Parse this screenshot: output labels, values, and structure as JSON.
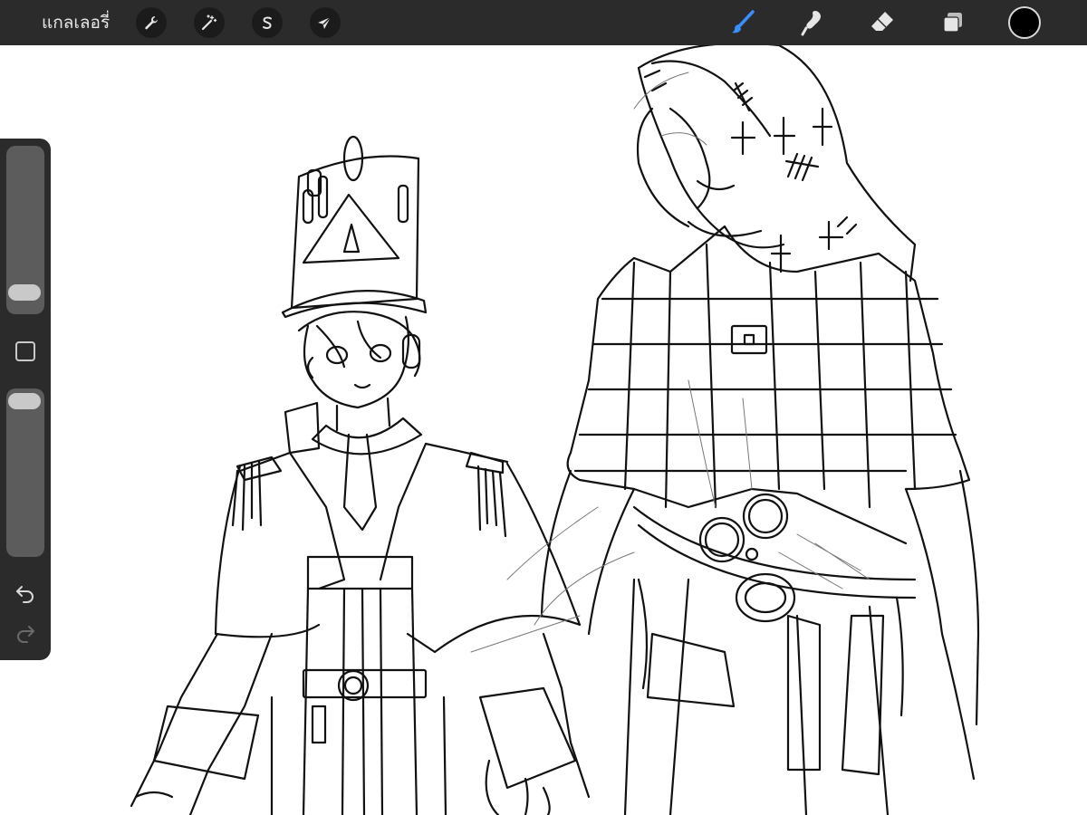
{
  "toolbar": {
    "gallery_label": "แกลเลอรี่",
    "left_tools": [
      {
        "icon": "wrench-icon",
        "name": "actions"
      },
      {
        "icon": "magic-wand-icon",
        "name": "adjustments"
      },
      {
        "icon": "selection-s-icon",
        "name": "selection"
      },
      {
        "icon": "arrow-cursor-icon",
        "name": "transform"
      }
    ],
    "right_tools": [
      {
        "icon": "brush-icon",
        "name": "paint",
        "active": true
      },
      {
        "icon": "smudge-icon",
        "name": "smudge",
        "active": false
      },
      {
        "icon": "eraser-icon",
        "name": "erase",
        "active": false
      },
      {
        "icon": "layers-icon",
        "name": "layers",
        "active": false
      }
    ],
    "current_color": "#000000",
    "active_tool_color": "#3a8dff"
  },
  "sidebar": {
    "brush_size_level": 0.15,
    "opacity_level": 1.0,
    "undo_icon": "undo-icon",
    "redo_icon": "redo-icon",
    "modify_icon": "square-icon"
  },
  "canvas": {
    "content": "sketch-drawing"
  }
}
